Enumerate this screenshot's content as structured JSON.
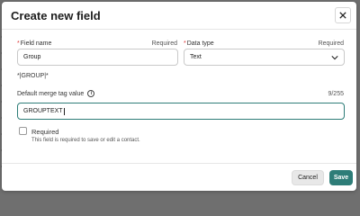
{
  "dialog": {
    "title": "Create new field",
    "close_label": "✕"
  },
  "field_name": {
    "label": "Field name",
    "required_marker": "*",
    "note": "Required",
    "value": "Group"
  },
  "data_type": {
    "label": "Data type",
    "required_marker": "*",
    "note": "Required",
    "selected": "Text"
  },
  "merge_tag": {
    "text": "*|GROUP|*"
  },
  "default_merge": {
    "label": "Default merge tag value",
    "info_icon": "info-icon",
    "count": "9/255",
    "value": "GROUPTEXT"
  },
  "required_option": {
    "label": "Required",
    "checked": false,
    "description": "This field is required to save or edit a contact."
  },
  "footer": {
    "cancel_label": "Cancel",
    "save_label": "Save"
  },
  "colors": {
    "accent": "#2e7d78",
    "required_marker": "#d33333",
    "backdrop": "#6f6f6f"
  }
}
